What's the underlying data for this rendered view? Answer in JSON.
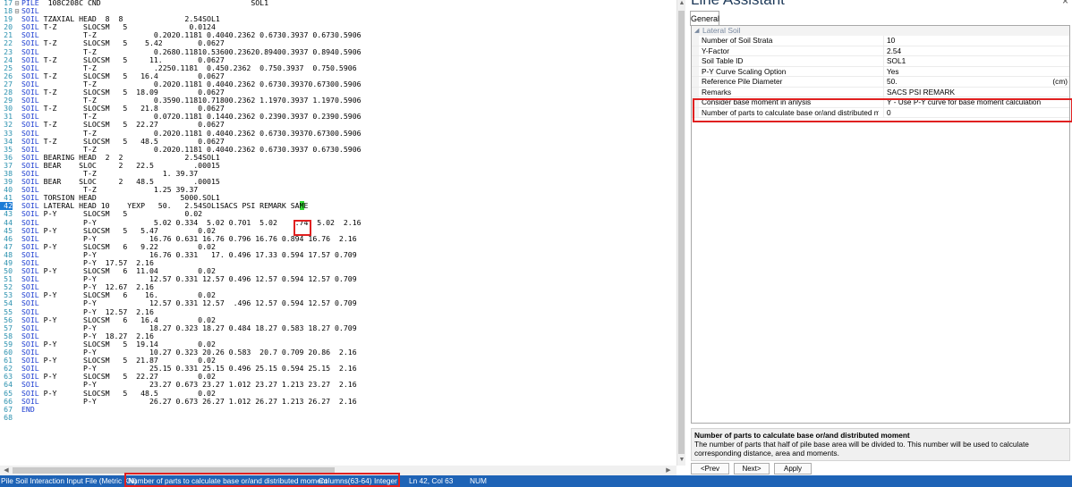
{
  "editor": {
    "lines": [
      {
        "n": "17",
        "fold": "⊟",
        "kw": "PILE",
        "rest": "  108C208C CND                                  SOL1"
      },
      {
        "n": "18",
        "fold": "⊟",
        "kw": "SOIL",
        "rest": ""
      },
      {
        "n": "19",
        "fold": "",
        "kw": "SOIL",
        "rest": " TZAXIAL HEAD  8  8              2.54SOL1"
      },
      {
        "n": "20",
        "fold": "",
        "kw": "SOIL",
        "rest": " T-Z      SLOCSM   5              0.0124"
      },
      {
        "n": "21",
        "fold": "",
        "kw": "SOIL",
        "rest": "          T-Z             0.2020.1181 0.4040.2362 0.6730.3937 0.6730.5906"
      },
      {
        "n": "22",
        "fold": "",
        "kw": "SOIL",
        "rest": " T-Z      SLOCSM   5    5.42        0.0627"
      },
      {
        "n": "23",
        "fold": "",
        "kw": "SOIL",
        "rest": "          T-Z             0.2680.11810.53600.23620.89400.3937 0.8940.5906"
      },
      {
        "n": "24",
        "fold": "",
        "kw": "SOIL",
        "rest": " T-Z      SLOCSM   5     11.        0.0627"
      },
      {
        "n": "25",
        "fold": "",
        "kw": "SOIL",
        "rest": "          T-Z             .2250.1181  0.450.2362  0.750.3937  0.750.5906"
      },
      {
        "n": "26",
        "fold": "",
        "kw": "SOIL",
        "rest": " T-Z      SLOCSM   5   16.4         0.0627"
      },
      {
        "n": "27",
        "fold": "",
        "kw": "SOIL",
        "rest": "          T-Z             0.2020.1181 0.4040.2362 0.6730.39370.67300.5906"
      },
      {
        "n": "28",
        "fold": "",
        "kw": "SOIL",
        "rest": " T-Z      SLOCSM   5  18.09         0.0627"
      },
      {
        "n": "29",
        "fold": "",
        "kw": "SOIL",
        "rest": "          T-Z             0.3590.11810.71800.2362 1.1970.3937 1.1970.5906"
      },
      {
        "n": "30",
        "fold": "",
        "kw": "SOIL",
        "rest": " T-Z      SLOCSM   5   21.8         0.0627"
      },
      {
        "n": "31",
        "fold": "",
        "kw": "SOIL",
        "rest": "          T-Z             0.0720.1181 0.1440.2362 0.2390.3937 0.2390.5906"
      },
      {
        "n": "32",
        "fold": "",
        "kw": "SOIL",
        "rest": " T-Z      SLOCSM   5  22.27         0.0627"
      },
      {
        "n": "33",
        "fold": "",
        "kw": "SOIL",
        "rest": "          T-Z             0.2020.1181 0.4040.2362 0.6730.39370.67300.5906"
      },
      {
        "n": "34",
        "fold": "",
        "kw": "SOIL",
        "rest": " T-Z      SLOCSM   5   48.5         0.0627"
      },
      {
        "n": "35",
        "fold": "",
        "kw": "SOIL",
        "rest": "          T-Z             0.2020.1181 0.4040.2362 0.6730.3937 0.6730.5906"
      },
      {
        "n": "36",
        "fold": "",
        "kw": "SOIL",
        "rest": " BEARING HEAD  2  2              2.54SOL1"
      },
      {
        "n": "37",
        "fold": "",
        "kw": "SOIL",
        "rest": " BEAR    SLOC     2   22.5         .00015"
      },
      {
        "n": "38",
        "fold": "",
        "kw": "SOIL",
        "rest": "          T-Z               1. 39.37"
      },
      {
        "n": "39",
        "fold": "",
        "kw": "SOIL",
        "rest": " BEAR    SLOC     2   48.5         .00015"
      },
      {
        "n": "40",
        "fold": "",
        "kw": "SOIL",
        "rest": "          T-Z             1.25 39.37"
      },
      {
        "n": "41",
        "fold": "",
        "kw": "SOIL",
        "rest": " TORSION HEAD                   5000.SOL1"
      },
      {
        "n": "42",
        "fold": "",
        "kw": "SOIL",
        "rest": " LATERAL HEAD 10    YEXP   50.   2.54SOL1SACS PSI REMARK SA",
        "hl": "M",
        "after": "E",
        "current": true
      },
      {
        "n": "43",
        "fold": "",
        "kw": "SOIL",
        "rest": " P-Y      SLOCSM   5             0.02"
      },
      {
        "n": "44",
        "fold": "",
        "kw": "SOIL",
        "rest": "          P-Y             5.02 0.334  5.02 0.701  5.02    .74  5.02  2.16"
      },
      {
        "n": "45",
        "fold": "",
        "kw": "SOIL",
        "rest": " P-Y      SLOCSM   5   5.47         0.02"
      },
      {
        "n": "46",
        "fold": "",
        "kw": "SOIL",
        "rest": "          P-Y            16.76 0.631 16.76 0.796 16.76 0.894 16.76  2.16"
      },
      {
        "n": "47",
        "fold": "",
        "kw": "SOIL",
        "rest": " P-Y      SLOCSM   6   9.22         0.02"
      },
      {
        "n": "48",
        "fold": "",
        "kw": "SOIL",
        "rest": "          P-Y            16.76 0.331   17. 0.496 17.33 0.594 17.57 0.709"
      },
      {
        "n": "49",
        "fold": "",
        "kw": "SOIL",
        "rest": "          P-Y  17.57  2.16"
      },
      {
        "n": "50",
        "fold": "",
        "kw": "SOIL",
        "rest": " P-Y      SLOCSM   6  11.04         0.02"
      },
      {
        "n": "51",
        "fold": "",
        "kw": "SOIL",
        "rest": "          P-Y            12.57 0.331 12.57 0.496 12.57 0.594 12.57 0.709"
      },
      {
        "n": "52",
        "fold": "",
        "kw": "SOIL",
        "rest": "          P-Y  12.67  2.16"
      },
      {
        "n": "53",
        "fold": "",
        "kw": "SOIL",
        "rest": " P-Y      SLOCSM   6    16.         0.02"
      },
      {
        "n": "54",
        "fold": "",
        "kw": "SOIL",
        "rest": "          P-Y            12.57 0.331 12.57  .496 12.57 0.594 12.57 0.709"
      },
      {
        "n": "55",
        "fold": "",
        "kw": "SOIL",
        "rest": "          P-Y  12.57  2.16"
      },
      {
        "n": "56",
        "fold": "",
        "kw": "SOIL",
        "rest": " P-Y      SLOCSM   6   16.4         0.02"
      },
      {
        "n": "57",
        "fold": "",
        "kw": "SOIL",
        "rest": "          P-Y            18.27 0.323 18.27 0.484 18.27 0.583 18.27 0.709"
      },
      {
        "n": "58",
        "fold": "",
        "kw": "SOIL",
        "rest": "          P-Y  18.27  2.16"
      },
      {
        "n": "59",
        "fold": "",
        "kw": "SOIL",
        "rest": " P-Y      SLOCSM   5  19.14         0.02"
      },
      {
        "n": "60",
        "fold": "",
        "kw": "SOIL",
        "rest": "          P-Y            10.27 0.323 20.26 0.583  20.7 0.709 20.86  2.16"
      },
      {
        "n": "61",
        "fold": "",
        "kw": "SOIL",
        "rest": " P-Y      SLOCSM   5  21.87         0.02"
      },
      {
        "n": "62",
        "fold": "",
        "kw": "SOIL",
        "rest": "          P-Y            25.15 0.331 25.15 0.496 25.15 0.594 25.15  2.16"
      },
      {
        "n": "63",
        "fold": "",
        "kw": "SOIL",
        "rest": " P-Y      SLOCSM   5  22.27         0.02"
      },
      {
        "n": "64",
        "fold": "",
        "kw": "SOIL",
        "rest": "          P-Y            23.27 0.673 23.27 1.012 23.27 1.213 23.27  2.16"
      },
      {
        "n": "65",
        "fold": "",
        "kw": "SOIL",
        "rest": " P-Y      SLOCSM   5   48.5         0.02"
      },
      {
        "n": "66",
        "fold": "",
        "kw": "SOIL",
        "rest": "          P-Y            26.27 0.673 26.27 1.012 26.27 1.213 26.27  2.16"
      },
      {
        "n": "67",
        "fold": "",
        "kw": "END",
        "rest": ""
      },
      {
        "n": "68",
        "fold": "",
        "kw": "",
        "rest": ""
      }
    ]
  },
  "panel": {
    "title": "Line Assistant",
    "close_glyph": "×",
    "tab_general": "General",
    "category": "Lateral Soil",
    "properties": [
      {
        "name": "Number of Soil Strata",
        "value": "10",
        "unit": ""
      },
      {
        "name": "Y-Factor",
        "value": "2.54",
        "unit": ""
      },
      {
        "name": "Soil Table ID",
        "value": "SOL1",
        "unit": ""
      },
      {
        "name": "P-Y Curve Scaling Option",
        "value": "Yes",
        "unit": ""
      },
      {
        "name": "Reference Pile Diameter",
        "value": "50.",
        "unit": "(cm)"
      },
      {
        "name": "Remarks",
        "value": "SACS PSI REMARK",
        "unit": ""
      },
      {
        "name": "Consider base moment in anlysis",
        "value": "Y - Use P-Y curve for base moment calculation",
        "unit": ""
      },
      {
        "name": "Number of parts to calculate base or/and distributed momer",
        "value": "0",
        "unit": ""
      }
    ],
    "description": {
      "title": "Number of parts to calculate base or/and distributed moment",
      "text": "The number of parts that half of pile base area will be divided to. This number will be used to calculate corresponding distance, area and moments."
    },
    "buttons": {
      "prev": "<Prev",
      "next": "Next>",
      "apply": "Apply"
    }
  },
  "status": {
    "file_type": "Pile Soil Interaction Input File (Metric KN)",
    "field_name": "Number of parts to calculate base or/and distributed moment",
    "columns": "Columns(63-64)",
    "data_type": "Integer",
    "position": "Ln 42, Col 63",
    "num": "NUM"
  },
  "colors": {
    "accent": "#1e63b6",
    "highlight_box": "#e02020",
    "keyword": "#1a3bd0",
    "cursor_highlight": "#35d835"
  }
}
